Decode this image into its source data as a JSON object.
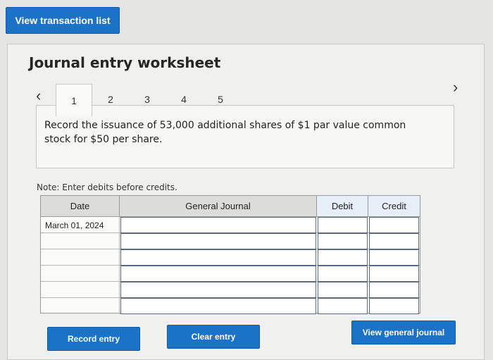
{
  "header": {
    "view_list_label": "View transaction list"
  },
  "worksheet": {
    "title": "Journal entry worksheet",
    "tabs": [
      "1",
      "2",
      "3",
      "4",
      "5"
    ],
    "active_tab": "1",
    "prompt": "Record the issuance of 53,000 additional shares of $1 par value common stock for $50 per share.",
    "note": "Note: Enter debits before credits."
  },
  "table": {
    "columns": [
      "Date",
      "General Journal",
      "Debit",
      "Credit"
    ],
    "rows": [
      [
        "March 01, 2024",
        "",
        "",
        ""
      ],
      [
        "",
        "",
        "",
        ""
      ],
      [
        "",
        "",
        "",
        ""
      ],
      [
        "",
        "",
        "",
        ""
      ],
      [
        "",
        "",
        "",
        ""
      ],
      [
        "",
        "",
        "",
        ""
      ]
    ]
  },
  "actions": {
    "record_label": "Record entry",
    "clear_label": "Clear entry",
    "view_journal_label": "View general journal"
  }
}
